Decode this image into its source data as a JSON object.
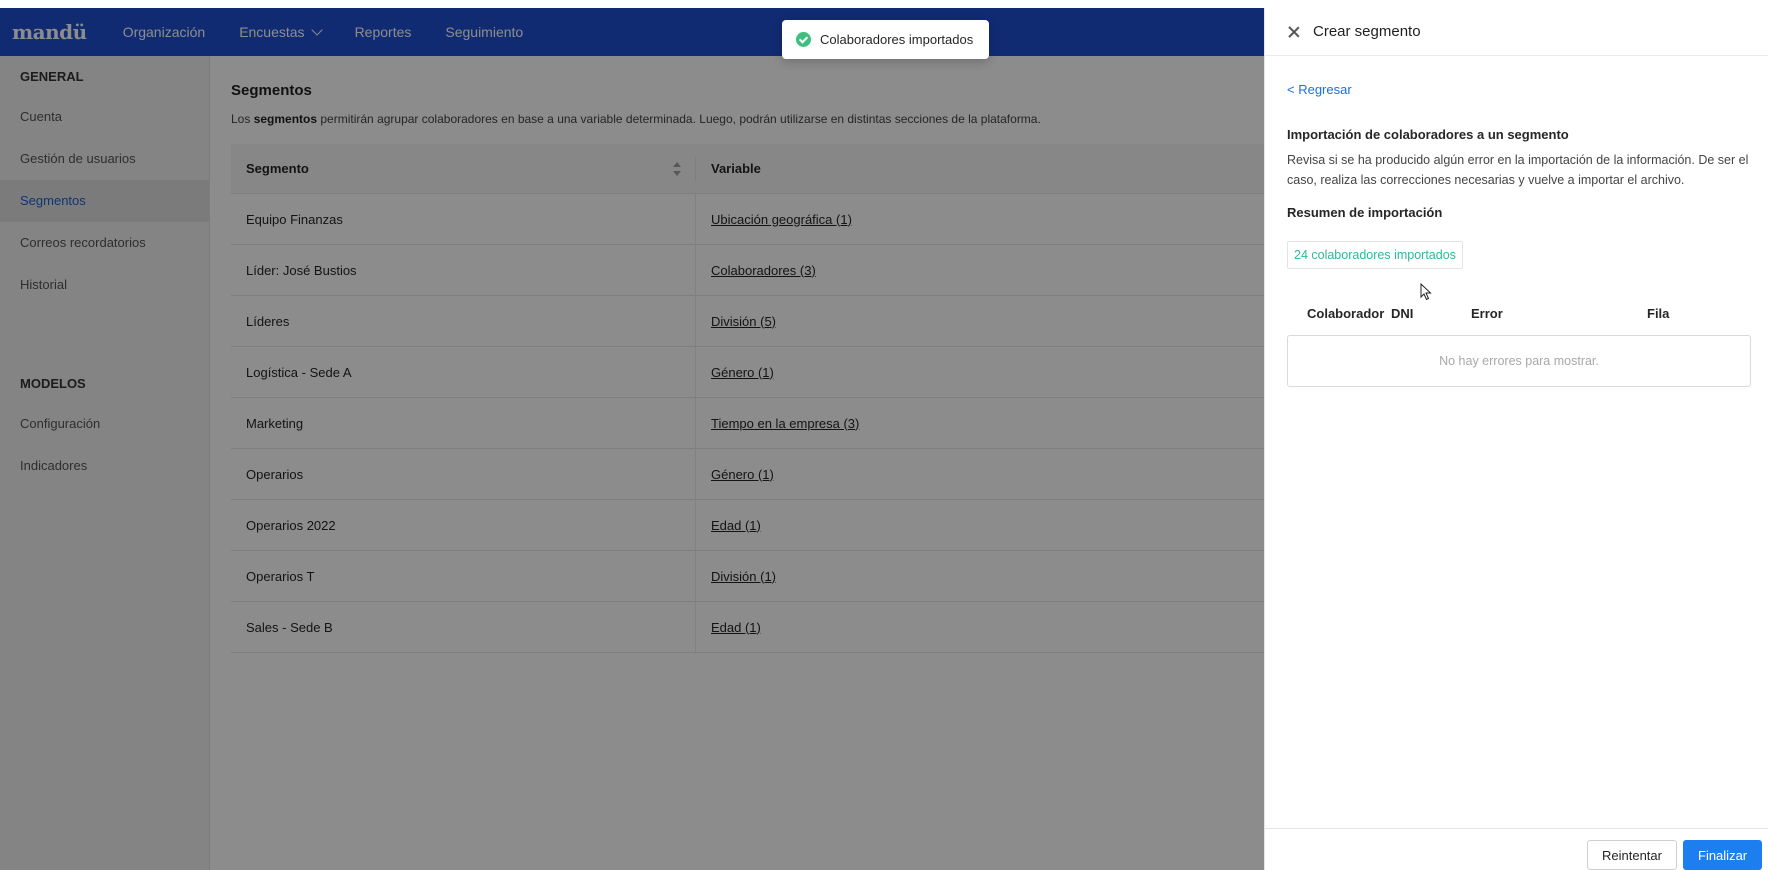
{
  "nav": {
    "logo": "mandü",
    "items": [
      {
        "label": "Organización"
      },
      {
        "label": "Encuestas",
        "has_dropdown": true
      },
      {
        "label": "Reportes"
      },
      {
        "label": "Seguimiento"
      }
    ]
  },
  "sidebar": {
    "section_general": "GENERAL",
    "general_items": [
      {
        "label": "Cuenta"
      },
      {
        "label": "Gestión de usuarios"
      },
      {
        "label": "Segmentos",
        "active": true
      },
      {
        "label": "Correos recordatorios"
      },
      {
        "label": "Historial"
      }
    ],
    "section_modelos": "MODELOS",
    "modelos_items": [
      {
        "label": "Configuración"
      },
      {
        "label": "Indicadores"
      }
    ]
  },
  "main": {
    "title": "Segmentos",
    "desc_before": "Los ",
    "desc_bold": "segmentos",
    "desc_after": " permitirán agrupar colaboradores en base a una variable determinada. Luego, podrán utilizarse en distintas secciones de la plataforma.",
    "columns": [
      "Segmento",
      "Variable"
    ],
    "rows": [
      {
        "segment": "Equipo Finanzas",
        "variable": "Ubicación geográfica (1)"
      },
      {
        "segment": "Líder: José Bustios",
        "variable": "Colaboradores (3)"
      },
      {
        "segment": "Líderes",
        "variable": "División (5)"
      },
      {
        "segment": "Logística - Sede A",
        "variable": "Género (1)"
      },
      {
        "segment": "Marketing",
        "variable": "Tiempo en la empresa (3)"
      },
      {
        "segment": "Operarios",
        "variable": "Género (1)"
      },
      {
        "segment": "Operarios 2022",
        "variable": "Edad (1)"
      },
      {
        "segment": "Operarios T",
        "variable": "División (1)"
      },
      {
        "segment": "Sales - Sede B",
        "variable": "Edad (1)"
      }
    ]
  },
  "toast": {
    "message": "Colaboradores importados",
    "icon": "check-circle-icon",
    "color": "#3fbf7f"
  },
  "drawer": {
    "title": "Crear segmento",
    "back_label": "< Regresar",
    "section_title": "Importación de colaboradores a un segmento",
    "section_desc": "Revisa si se ha producido algún error en la importación de la información. De ser el caso, realiza las correcciones necesarias y vuelve a importar el archivo.",
    "summary_title": "Resumen de importación",
    "success_count": "24",
    "success_text": " colaboradores importados",
    "error_columns": [
      "Colaborador",
      "DNI",
      "Error",
      "Fila"
    ],
    "empty_text": "No hay errores para mostrar.",
    "retry_label": "Reintentar",
    "finish_label": "Finalizar"
  },
  "colors": {
    "nav_bg": "#1f4fd1",
    "accent": "#1d7fef",
    "success": "#2fb79a"
  }
}
